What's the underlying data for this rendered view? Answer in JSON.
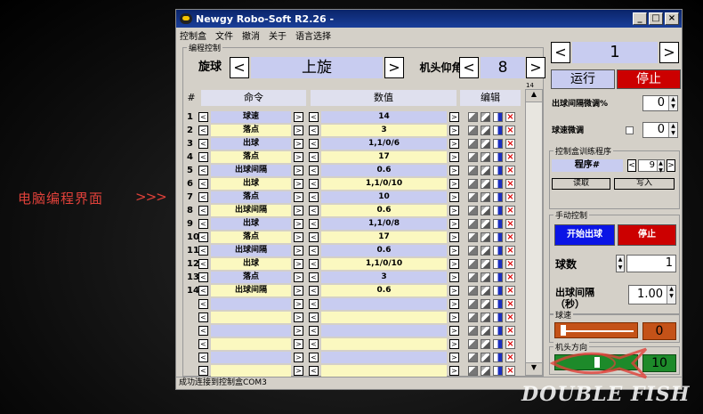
{
  "side_label": "电脑编程界面",
  "side_arrows": ">>>",
  "window": {
    "title": "Newgy Robo-Soft R2.26 -",
    "min": "_",
    "max": "□",
    "close": "×"
  },
  "menu": [
    "控制盒",
    "文件",
    "撤消",
    "关于",
    "语言选择"
  ],
  "editor": {
    "group_label": "编程控制",
    "spin_label": "旋球",
    "spin_value": "上旋",
    "angle_label": "机头仰角",
    "angle_value": "8",
    "row_count": "14",
    "headers": {
      "num": "#",
      "cmd": "命令",
      "val": "数值",
      "edit": "编辑"
    }
  },
  "rows": [
    {
      "n": "1",
      "cmd": "球速",
      "val": "14"
    },
    {
      "n": "2",
      "cmd": "落点",
      "val": "3"
    },
    {
      "n": "3",
      "cmd": "出球",
      "val": "1,1/0/6"
    },
    {
      "n": "4",
      "cmd": "落点",
      "val": "17"
    },
    {
      "n": "5",
      "cmd": "出球间隔",
      "val": "0.6"
    },
    {
      "n": "6",
      "cmd": "出球",
      "val": "1,1/0/10"
    },
    {
      "n": "7",
      "cmd": "落点",
      "val": "10"
    },
    {
      "n": "8",
      "cmd": "出球间隔",
      "val": "0.6"
    },
    {
      "n": "9",
      "cmd": "出球",
      "val": "1,1/0/8"
    },
    {
      "n": "10",
      "cmd": "落点",
      "val": "17"
    },
    {
      "n": "11",
      "cmd": "出球间隔",
      "val": "0.6"
    },
    {
      "n": "12",
      "cmd": "出球",
      "val": "1,1/0/10"
    },
    {
      "n": "13",
      "cmd": "落点",
      "val": "3"
    },
    {
      "n": "14",
      "cmd": "出球间隔",
      "val": "0.6"
    },
    {
      "n": "",
      "cmd": "",
      "val": ""
    },
    {
      "n": "",
      "cmd": "",
      "val": ""
    },
    {
      "n": "",
      "cmd": "",
      "val": ""
    },
    {
      "n": "",
      "cmd": "",
      "val": ""
    },
    {
      "n": "",
      "cmd": "",
      "val": ""
    },
    {
      "n": "",
      "cmd": "",
      "val": ""
    }
  ],
  "right": {
    "program_no": "1",
    "run": "运行",
    "stop": "停止",
    "interval_adj_label": "出球间隔微调%",
    "interval_adj_value": "0",
    "speed_adj_label": "球速微调",
    "speed_adj_value": "0",
    "box_group": "控制盒训练程序",
    "program_label": "程序#",
    "program_value": "9",
    "read_btn": "读取",
    "write_btn": "写入",
    "manual_group": "手动控制",
    "start_ball": "开始出球",
    "manual_stop": "停止",
    "ball_count_label": "球数",
    "ball_count_value": "1",
    "interval_label": "出球间隔",
    "interval_unit": "（秒）",
    "interval_value": "1.00",
    "speed_group": "球速",
    "speed_value": "0",
    "head_group": "机头方向",
    "head_value": "10"
  },
  "status": "成功连接到控制盒COM3",
  "brand": "DOUBLE FISH",
  "colors": {
    "accent": "#e0413a",
    "run": "#c8ccf0",
    "stop": "#cc0000",
    "row_blue": "#c8ccf0",
    "row_yellow": "#fbf8c0"
  }
}
